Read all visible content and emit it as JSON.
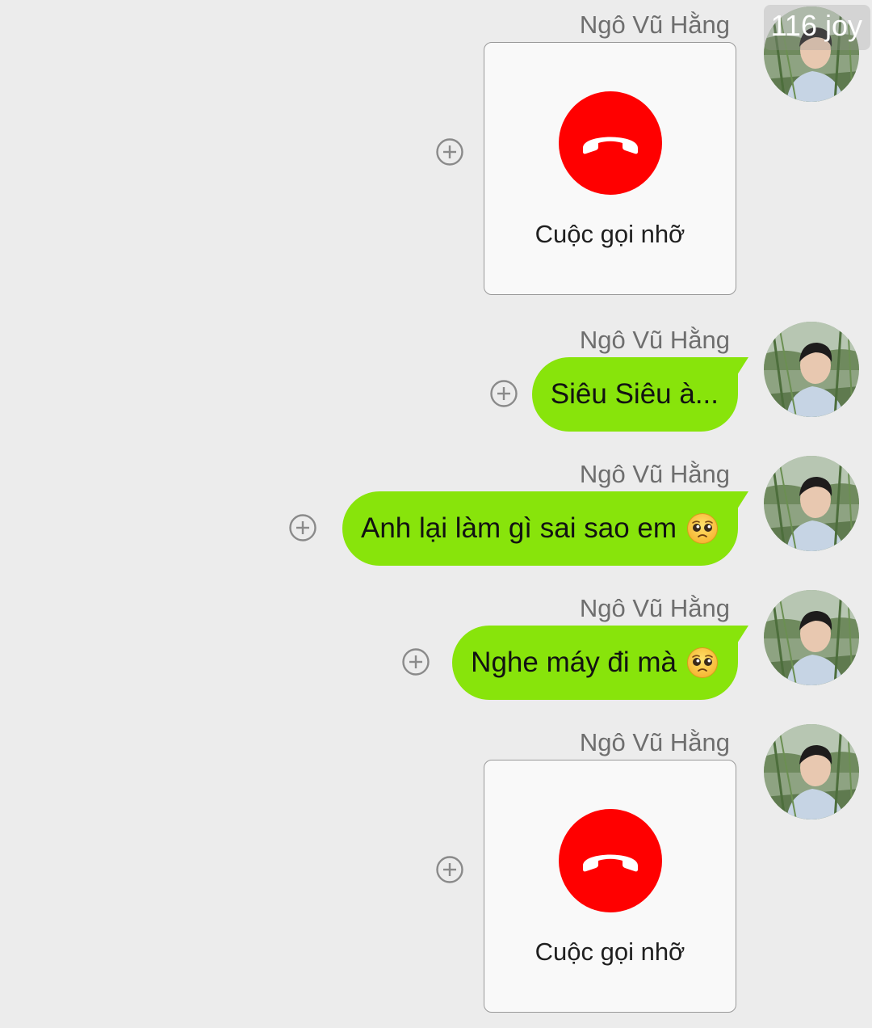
{
  "watermark": "116 joy",
  "messages": [
    {
      "sender": "Ngô Vũ Hằng",
      "type": "call",
      "label": "Cuộc gọi nhỡ"
    },
    {
      "sender": "Ngô Vũ Hằng",
      "type": "text",
      "text": "Siêu Siêu à..."
    },
    {
      "sender": "Ngô Vũ Hằng",
      "type": "text",
      "text": "Anh lại làm gì sai sao em",
      "emoji": "pleading-face-emoji"
    },
    {
      "sender": "Ngô Vũ Hằng",
      "type": "text",
      "text": "Nghe máy đi mà",
      "emoji": "pleading-face-emoji"
    },
    {
      "sender": "Ngô Vũ Hằng",
      "type": "call",
      "label": "Cuộc gọi nhỡ"
    }
  ],
  "colors": {
    "background": "#ececec",
    "bubble": "#88e40b",
    "missed_call": "#ff0000"
  },
  "icons": {
    "add": "plus-circle-icon",
    "call": "missed-call-icon",
    "avatar": "avatar"
  }
}
